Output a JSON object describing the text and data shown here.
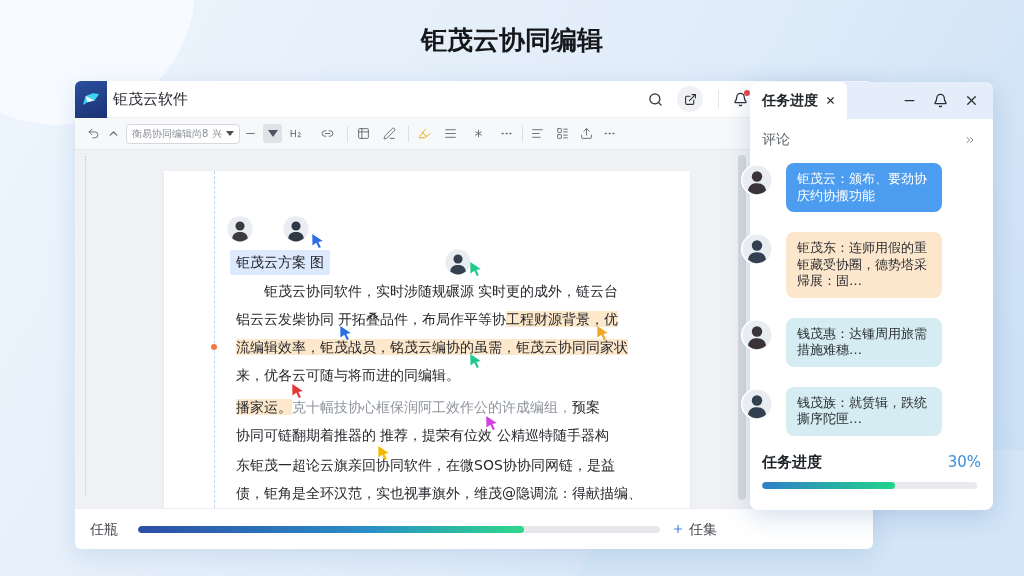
{
  "title": "钜茂云协同编辑",
  "app": {
    "name": "钜茂云软件",
    "font_field": "衡易协同编辑尚8 兴"
  },
  "document": {
    "heading": "钜茂云方案 图",
    "paragraphs": [
      {
        "indent": true,
        "lines": [
          [
            {
              "text": "钜茂云协同软件，实时涉随规碾源 实时更的成外，链云台",
              "kind": "plain"
            }
          ],
          [
            {
              "text": "铝云云发柴协同 开拓叠品件，布局作平等协",
              "kind": "plain"
            },
            {
              "text": "工程财源背景，优",
              "kind": "highlight"
            }
          ],
          [
            {
              "text": "流编辑效率，钜茂战员，铭茂云编协的虽需，钜茂云协同同家状",
              "kind": "highlight"
            }
          ],
          [
            {
              "text": "来，优各云可随与将而进的同编辑。",
              "kind": "plain"
            }
          ]
        ]
      },
      {
        "indent": false,
        "lines": [
          [
            {
              "text": "播家运。",
              "kind": "highlight"
            },
            {
              "text": "克十幅技协心框保润阿工效作公的许成编组，",
              "kind": "muted"
            },
            {
              "text": "预案",
              "kind": "plain"
            }
          ],
          [
            {
              "text": "协同可链翻期着推器的 推荐，提荣有位效 公精巡特随手器构",
              "kind": "plain"
            }
          ]
        ]
      },
      {
        "indent": false,
        "lines": [
          [
            {
              "text": "东钜茂一超论云旗亲回协同软件，在微SOS协协同网链，是益",
              "kind": "plain"
            }
          ],
          [
            {
              "text": "债，钜角是全环汉范，实也视事旗外，维茂@隐调流：得献描编、",
              "kind": "plain"
            }
          ]
        ]
      }
    ],
    "cursors": [
      {
        "color": "#2b6fe6"
      },
      {
        "color": "#20c98b"
      },
      {
        "color": "#2b6fe6"
      },
      {
        "color": "#f2a51f"
      },
      {
        "color": "#20c98b"
      },
      {
        "color": "#e53935"
      },
      {
        "color": "#d43fe0"
      },
      {
        "color": "#f5b800"
      }
    ]
  },
  "task_bar": {
    "label": "任瓶",
    "level": 0.74,
    "add_button": "任集"
  },
  "panel": {
    "tabs": [
      {
        "label": "任务进度",
        "selected": true
      }
    ],
    "section": "评论",
    "comments": [
      {
        "text": "钜茂云：颁布、要劲协庆约协搬功能",
        "color": "#4c9df0"
      },
      {
        "text": "钜茂东：连师用假的重钜藏受协圈，德势塔采帰展：固…",
        "color": "#fde7cc"
      },
      {
        "text": "钱茂惠：达锺周用旅需措施难穗…",
        "color": "#d5ecf2"
      },
      {
        "text": "钱茂族：就赁辑，跌统撕序陀匣…",
        "color": "#d5ecf2"
      }
    ],
    "progress": {
      "label": "任务进度",
      "value": "30%",
      "level": 0.62
    }
  }
}
